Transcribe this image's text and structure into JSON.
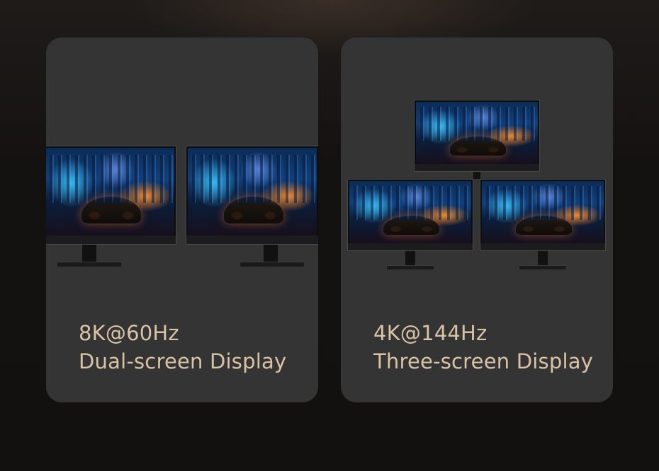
{
  "cards": [
    {
      "resolution": "8K@60Hz",
      "mode": "Dual-screen Display"
    },
    {
      "resolution": "4K@144Hz",
      "mode": "Three-screen Display"
    }
  ],
  "colors": {
    "background": "#151312",
    "card": "#353434",
    "caption": "#d8c3a4"
  },
  "icons": [
    "monitor-icon"
  ]
}
